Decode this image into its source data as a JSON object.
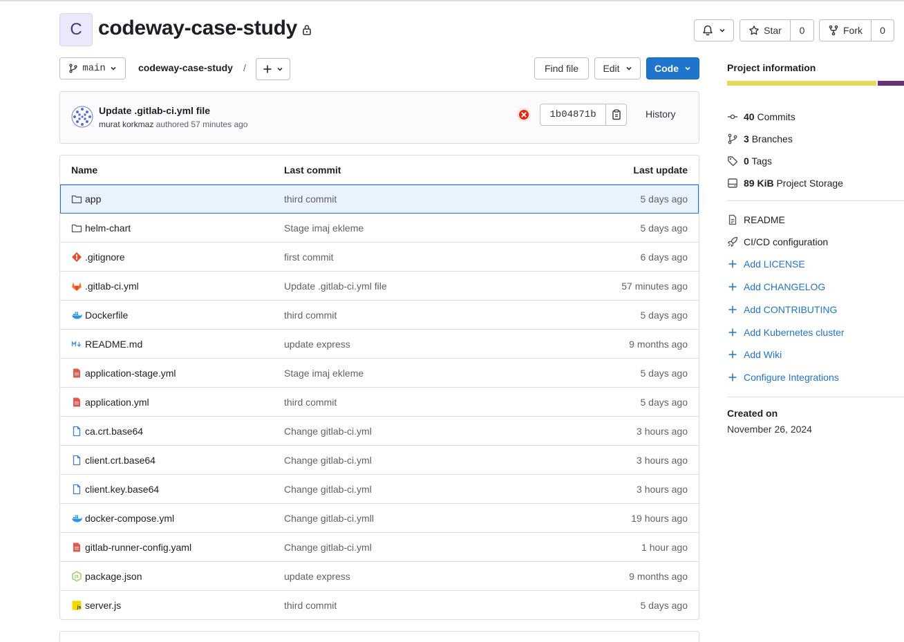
{
  "project": {
    "avatar_letter": "C",
    "name": "codeway-case-study",
    "visibility_icon": "lock-icon"
  },
  "header_actions": {
    "notifications_icon": "bell-icon",
    "star_label": "Star",
    "star_count": "0",
    "fork_label": "Fork",
    "fork_count": "0"
  },
  "toolbar": {
    "branch": "main",
    "breadcrumb": "codeway-case-study",
    "breadcrumb_sep": "/",
    "find_file_label": "Find file",
    "edit_label": "Edit",
    "code_label": "Code"
  },
  "last_commit": {
    "title": "Update .gitlab-ci.yml file",
    "author": "murat korkmaz",
    "meta_suffix": "authored 57 minutes ago",
    "pipeline_status": "failed",
    "sha": "1b04871b",
    "history_label": "History"
  },
  "table": {
    "headers": {
      "name": "Name",
      "last_commit": "Last commit",
      "last_update": "Last update"
    },
    "rows": [
      {
        "icon": "folder-icon",
        "name": "app",
        "commit": "third commit",
        "updated": "5 days ago",
        "selected": true
      },
      {
        "icon": "folder-icon",
        "name": "helm-chart",
        "commit": "Stage imaj ekleme",
        "updated": "5 days ago"
      },
      {
        "icon": "git-icon",
        "name": ".gitignore",
        "commit": "first commit",
        "updated": "6 days ago"
      },
      {
        "icon": "gitlab-icon",
        "name": ".gitlab-ci.yml",
        "commit": "Update .gitlab-ci.yml file",
        "updated": "57 minutes ago"
      },
      {
        "icon": "docker-icon",
        "name": "Dockerfile",
        "commit": "third commit",
        "updated": "5 days ago"
      },
      {
        "icon": "markdown-icon",
        "name": "README.md",
        "commit": "update express",
        "updated": "9 months ago"
      },
      {
        "icon": "yaml-icon",
        "name": "application-stage.yml",
        "commit": "Stage imaj ekleme",
        "updated": "5 days ago"
      },
      {
        "icon": "yaml-icon",
        "name": "application.yml",
        "commit": "third commit",
        "updated": "5 days ago"
      },
      {
        "icon": "file-icon",
        "name": "ca.crt.base64",
        "commit": "Change gitlab-ci.yml",
        "updated": "3 hours ago"
      },
      {
        "icon": "file-icon",
        "name": "client.crt.base64",
        "commit": "Change gitlab-ci.yml",
        "updated": "3 hours ago"
      },
      {
        "icon": "file-icon",
        "name": "client.key.base64",
        "commit": "Change gitlab-ci.yml",
        "updated": "3 hours ago"
      },
      {
        "icon": "docker-icon",
        "name": "docker-compose.yml",
        "commit": "Change gitlab-ci.ymll",
        "updated": "19 hours ago"
      },
      {
        "icon": "yaml-icon",
        "name": "gitlab-runner-config.yaml",
        "commit": "Change gitlab-ci.yml",
        "updated": "1 hour ago"
      },
      {
        "icon": "nodejs-icon",
        "name": "package.json",
        "commit": "update express",
        "updated": "9 months ago"
      },
      {
        "icon": "javascript-icon",
        "name": "server.js",
        "commit": "third commit",
        "updated": "5 days ago"
      }
    ]
  },
  "sidebar": {
    "title": "Project information",
    "language_colors": [
      "#e6d85a",
      "#6b2f7a"
    ],
    "stats": [
      {
        "icon": "commit-icon",
        "value": "40",
        "label": "Commits"
      },
      {
        "icon": "branch-icon",
        "value": "3",
        "label": "Branches"
      },
      {
        "icon": "tag-icon",
        "value": "0",
        "label": "Tags"
      },
      {
        "icon": "storage-icon",
        "value": "89 KiB",
        "label": "Project Storage"
      }
    ],
    "links": [
      {
        "icon": "document-icon",
        "label": "README",
        "style": "plain"
      },
      {
        "icon": "rocket-icon",
        "label": "CI/CD configuration",
        "style": "plain"
      },
      {
        "icon": "plus-icon",
        "label": "Add LICENSE",
        "style": "blue"
      },
      {
        "icon": "plus-icon",
        "label": "Add CHANGELOG",
        "style": "blue"
      },
      {
        "icon": "plus-icon",
        "label": "Add CONTRIBUTING",
        "style": "blue"
      },
      {
        "icon": "plus-icon",
        "label": "Add Kubernetes cluster",
        "style": "blue"
      },
      {
        "icon": "plus-icon",
        "label": "Add Wiki",
        "style": "blue"
      },
      {
        "icon": "plus-icon",
        "label": "Configure Integrations",
        "style": "blue"
      }
    ],
    "created_label": "Created on",
    "created_date": "November 26, 2024"
  },
  "colors": {
    "accent": "#1f75cb",
    "failed": "#dd2b0e",
    "selected_row": "#e9f3fc"
  }
}
